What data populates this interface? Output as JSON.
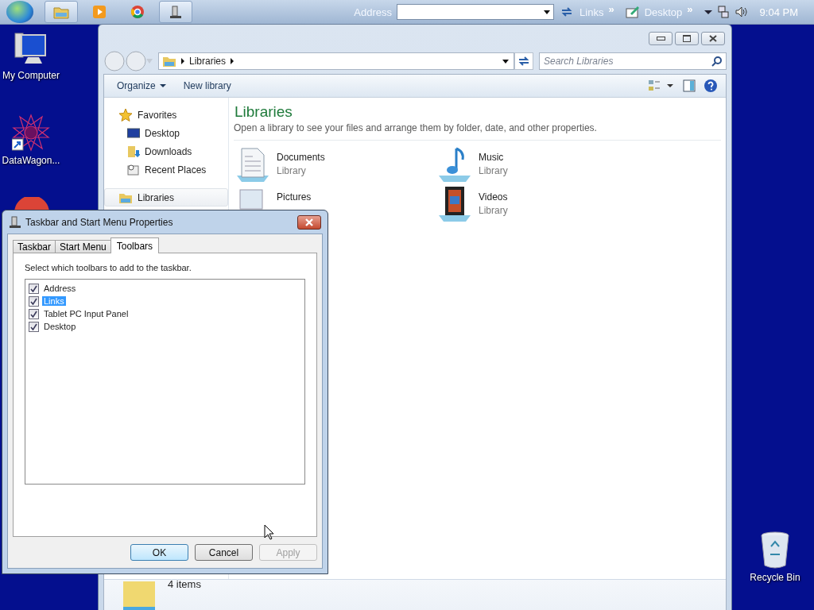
{
  "taskbar": {
    "apps": [
      {
        "kind": "explorer",
        "active": true
      },
      {
        "kind": "media",
        "active": false
      },
      {
        "kind": "browser",
        "active": false
      },
      {
        "kind": "properties",
        "active": true
      }
    ],
    "address_label": "Address",
    "links_label": "Links",
    "links_chevron": "»",
    "desktop_label": "Desktop",
    "desktop_chevron": "»",
    "clock": "9:04 PM"
  },
  "desktop_icons": [
    {
      "kind": "computer",
      "label": "My Computer"
    },
    {
      "kind": "app",
      "label": "DataWagon..."
    },
    {
      "kind": "recycle",
      "label": "Recycle Bin"
    }
  ],
  "explorer": {
    "breadcrumbs": [
      "Libraries"
    ],
    "search": {
      "placeholder": "Search Libraries"
    },
    "toolbar": [
      {
        "label": "Organize",
        "menu": true
      },
      {
        "label": "New library",
        "menu": false
      }
    ],
    "nav": [
      {
        "kind": "favorites",
        "label": "Favorites",
        "selected": false,
        "children": [
          {
            "kind": "desktop",
            "label": "Desktop",
            "selected": false
          },
          {
            "kind": "downloads",
            "label": "Downloads",
            "selected": false
          },
          {
            "kind": "recent",
            "label": "Recent Places",
            "selected": false
          }
        ]
      },
      {
        "kind": "libraries",
        "label": "Libraries",
        "selected": true
      }
    ],
    "heading": "Libraries",
    "description": "Open a library to see your files and arrange them by folder, date, and other properties.",
    "libraries": [
      {
        "kind": "documents",
        "name": "Documents",
        "type": "Library"
      },
      {
        "kind": "music",
        "name": "Music",
        "type": "Library"
      },
      {
        "kind": "pictures",
        "name": "Pictures"
      },
      {
        "kind": "videos",
        "name": "Videos",
        "type": "Library"
      }
    ],
    "status": "4 items"
  },
  "dialog": {
    "title": "Taskbar and Start Menu Properties",
    "tabs": [
      {
        "label": "Taskbar",
        "selected": false
      },
      {
        "label": "Start Menu",
        "selected": false
      },
      {
        "label": "Toolbars",
        "selected": true
      }
    ],
    "instruction": "Select which toolbars to add to the taskbar.",
    "toolbars": [
      {
        "label": "Address",
        "checked": true,
        "selected": false
      },
      {
        "label": "Links",
        "checked": true,
        "selected": true
      },
      {
        "label": "Tablet PC Input Panel",
        "checked": true,
        "selected": false
      },
      {
        "label": "Desktop",
        "checked": true,
        "selected": false
      }
    ],
    "buttons": [
      {
        "label": "OK",
        "default": true,
        "disabled": false
      },
      {
        "label": "Cancel",
        "default": false,
        "disabled": false
      },
      {
        "label": "Apply",
        "default": false,
        "disabled": true
      }
    ]
  }
}
